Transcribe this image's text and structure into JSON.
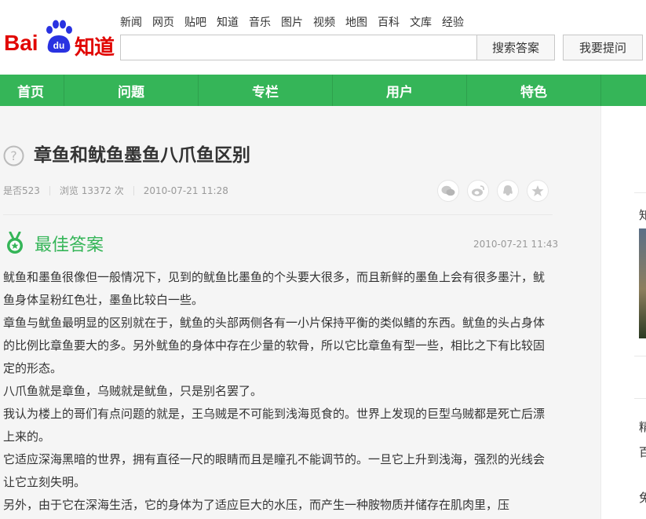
{
  "logo": {
    "bai": "Bai",
    "du": "du",
    "zhidao": "知道"
  },
  "topnav": [
    "新闻",
    "网页",
    "贴吧",
    "知道",
    "音乐",
    "图片",
    "视频",
    "地图",
    "百科",
    "文库",
    "经验"
  ],
  "search": {
    "value": "",
    "placeholder": "",
    "search_button": "搜索答案",
    "ask_button": "我要提问"
  },
  "mainnav": [
    "首页",
    "问题",
    "专栏",
    "用户",
    "特色"
  ],
  "question": {
    "title": "章鱼和鱿鱼墨鱼八爪鱼区别",
    "author": "是否523",
    "views": "浏览 13372 次",
    "time": "2010-07-21 11:28"
  },
  "best_answer": {
    "label": "最佳答案",
    "time": "2010-07-21 11:43",
    "paragraphs": [
      "鱿鱼和墨鱼很像但一般情况下，见到的鱿鱼比墨鱼的个头要大很多，而且新鲜的墨鱼上会有很多墨汁，鱿鱼身体呈粉红色壮，墨鱼比较白一些。",
      "章鱼与鱿鱼最明显的区别就在于，鱿鱼的头部两侧各有一小片保持平衡的类似鳍的东西。鱿鱼的头占身体的比例比章鱼要大的多。另外鱿鱼的身体中存在少量的软骨，所以它比章鱼有型一些，相比之下有比较固定的形态。",
      "八爪鱼就是章鱼，乌贼就是鱿鱼，只是别名罢了。",
      "我认为楼上的哥们有点问题的就是，王乌贼是不可能到浅海觅食的。世界上发现的巨型乌贼都是死亡后漂上来的。",
      "它适应深海黑暗的世界，拥有直径一尺的眼睛而且是瞳孔不能调节的。一旦它上升到浅海，强烈的光线会让它立刻失明。",
      "另外，由于它在深海生活，它的身体为了适应巨大的水压，而产生一种胺物质并储存在肌肉里，压"
    ]
  },
  "sidebar": {
    "frag1": "知",
    "frag2": "精",
    "frag3": "百",
    "frag4": "免"
  },
  "colors": {
    "brand_green": "#35b558",
    "logo_red": "#e10602",
    "logo_blue": "#2932e1"
  }
}
